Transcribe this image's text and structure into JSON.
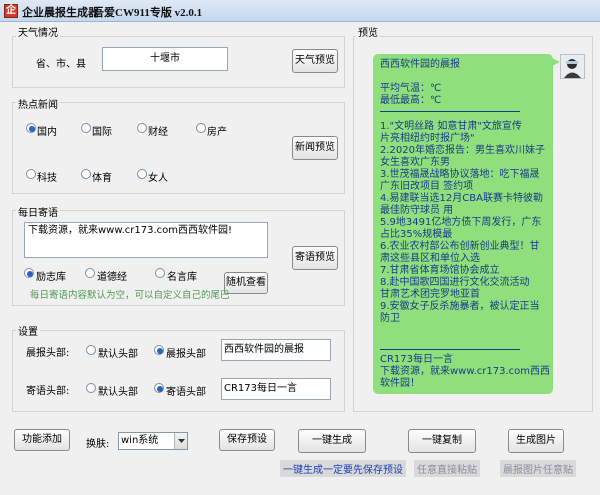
{
  "window": {
    "title": "企业晨报生成器",
    "subtitle": "吾爱CW911专版 v2.0.1"
  },
  "weather": {
    "group_label": "天气情况",
    "location_label": "省、市、县",
    "location_value": "十堰市",
    "preview_button": "天气预览"
  },
  "news": {
    "group_label": "热点新闻",
    "options": [
      "国内",
      "国际",
      "财经",
      "房产",
      "科技",
      "体育",
      "女人"
    ],
    "selected": "国内",
    "preview_button": "新闻预览"
  },
  "quote": {
    "group_label": "每日寄语",
    "text": "下载资源，就来www.cr173.com西西软件园!",
    "options": [
      "励志库",
      "道德经",
      "名言库"
    ],
    "selected": "励志库",
    "random_button": "随机查看",
    "preview_button": "寄语预览",
    "hint": "每日寄语内容默认为空，可以自定义自己的尾巴"
  },
  "settings": {
    "group_label": "设置",
    "morning_header": {
      "label": "晨报头部:",
      "options": [
        "默认头部",
        "晨报头部"
      ],
      "selected": "晨报头部",
      "value": "西西软件园的晨报"
    },
    "quote_header": {
      "label": "寄语头部:",
      "options": [
        "默认头部",
        "寄语头部"
      ],
      "selected": "寄语头部",
      "value": "CR173每日一言"
    }
  },
  "preview": {
    "group_label": "预览",
    "lines_top": [
      "西西软件园的晨报",
      "",
      "平均气温：℃",
      "最低最高：℃"
    ],
    "lines_news": [
      "1.\"文明丝路 如意甘肃\"文旅宣传",
      "片亮相纽约时报广场\"",
      "2.2020年婚恋报告：男生喜欢川妹子",
      "女生喜欢广东男",
      "3.世茂福晟战略协议落地：吃下福晟",
      "广东旧改项目 签约项",
      "4.易建联当选12月CBA联赛卡特彼勒",
      "最佳防守球员 用",
      "5.9地3491亿地方债下周发行，广东",
      "占比35%规模最",
      "6.农业农村部公布创新创业典型！甘",
      "肃这些县区和单位入选",
      "7.甘肃省体育场馆协会成立",
      "8.赴中国歌四国进行文化交流活动",
      "甘肃艺术团完罗地亚首",
      "9.安徽女子反杀施暴者，被认定正当",
      "防卫"
    ],
    "lines_bottom": [
      "CR173每日一言",
      "下载资源，就来www.cr173.com西西",
      "软件园！"
    ]
  },
  "footer": {
    "add_button": "功能添加",
    "skin_label": "换肤:",
    "skin_value": "win系统",
    "save_button": "保存预设",
    "generate_button": "一键生成",
    "generate_hint": "一键生成一定要先保存预设",
    "copy_button": "一键复制",
    "copy_hint": "任意直接粘贴",
    "image_button": "生成图片",
    "image_hint": "晨报图片任意贴"
  },
  "colors": {
    "bubble": "#8fe07c",
    "bubble_text": "#1a3a8a",
    "hint_green": "#4f9b52",
    "hint_blue": "#1a3fb5"
  }
}
